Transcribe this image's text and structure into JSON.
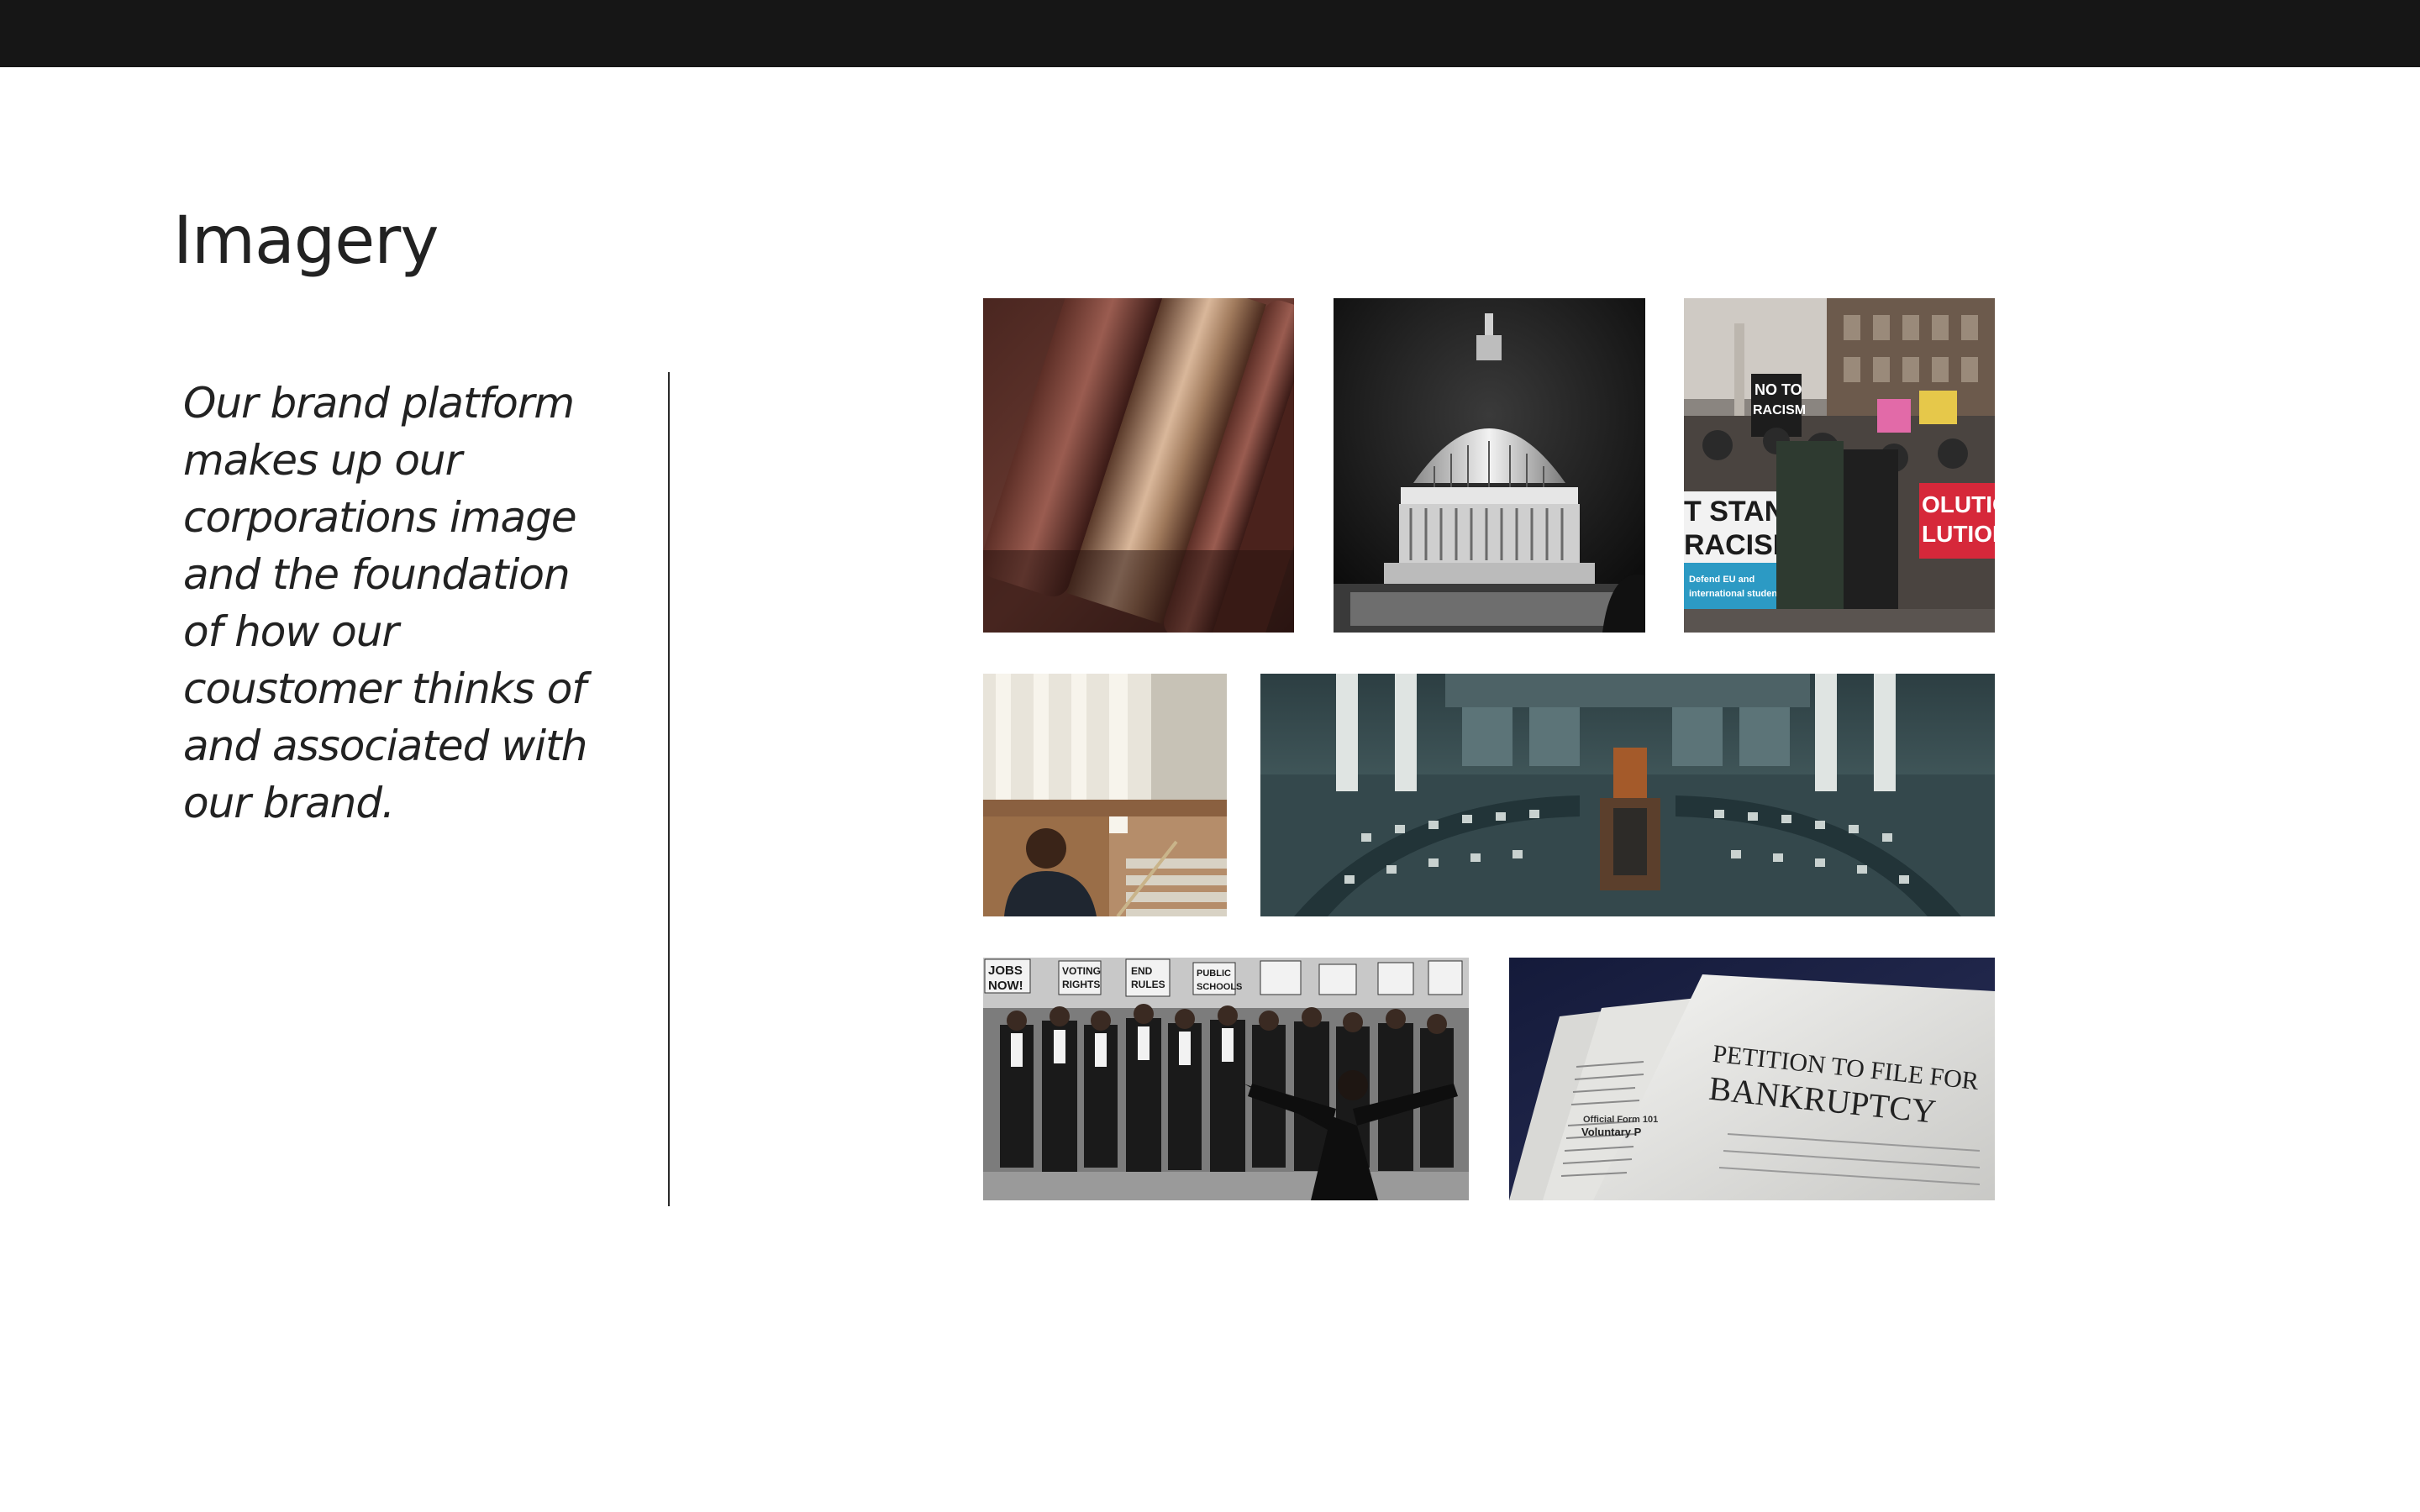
{
  "page": {
    "title": "Imagery",
    "body": "Our brand platform makes up our corporations image and the foundation of how our coustomer thinks of and associated with our brand."
  },
  "gallery": {
    "protest": {
      "sign_top_1": "NO TO",
      "sign_top_2": "RACISM",
      "banner_left_1": "T STAN",
      "banner_left_2": "RACISM",
      "banner_left_3": "Defend EU and",
      "banner_left_4": "international students",
      "banner_right_1": "OLUTIO",
      "banner_right_2": "LUTION"
    },
    "march": {
      "sign_1": "JOBS",
      "sign_2": "NOW!",
      "sign_3": "VOTING",
      "sign_4": "RIGHTS",
      "sign_5": "END",
      "sign_6": "RULES",
      "sign_7": "PUBLIC",
      "sign_8": "SCHOOLS"
    },
    "petition": {
      "heading_1": "PETITION TO FILE FOR",
      "heading_2": "BANKRUPTCY",
      "form_label": "Official Form 101",
      "form_heading": "Voluntary P"
    }
  },
  "colors": {
    "topbar": "#161616",
    "text": "#222222",
    "divider": "#2a2a2a"
  }
}
